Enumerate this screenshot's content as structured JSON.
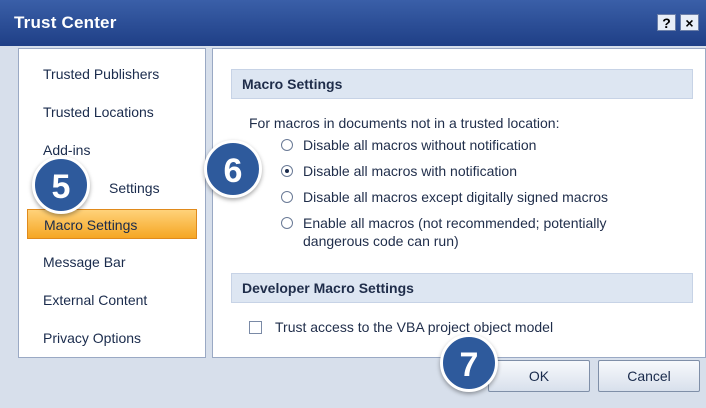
{
  "window": {
    "title": "Trust Center",
    "help_glyph": "?",
    "close_glyph": "×"
  },
  "sidebar": {
    "items": [
      {
        "label": "Trusted Publishers",
        "selected": false
      },
      {
        "label": "Trusted Locations",
        "selected": false
      },
      {
        "label": "Add-ins",
        "selected": false
      },
      {
        "label": "Settings",
        "selected": false
      },
      {
        "label": "Macro Settings",
        "selected": true
      },
      {
        "label": "Message Bar",
        "selected": false
      },
      {
        "label": "External Content",
        "selected": false
      },
      {
        "label": "Privacy Options",
        "selected": false
      }
    ]
  },
  "macro_settings": {
    "heading": "Macro Settings",
    "intro": "For macros in documents not in a trusted location:",
    "options": [
      {
        "label": "Disable all macros without notification",
        "selected": false
      },
      {
        "label": "Disable all macros with notification",
        "selected": true
      },
      {
        "label": "Disable all macros except digitally signed macros",
        "selected": false
      },
      {
        "label_line1": "Enable all macros (not recommended; potentially",
        "label_line2": "dangerous code can run)",
        "selected": false
      }
    ]
  },
  "developer": {
    "heading": "Developer Macro Settings",
    "vba_label": "Trust access to the VBA project object model",
    "vba_checked": false
  },
  "buttons": {
    "ok": "OK",
    "cancel": "Cancel"
  },
  "callouts": {
    "step5": "5",
    "step6": "6",
    "step7": "7"
  },
  "colors": {
    "title_bar": "#2b4f97",
    "selected_item": "#f5a623",
    "callout": "#2e5a9c"
  }
}
